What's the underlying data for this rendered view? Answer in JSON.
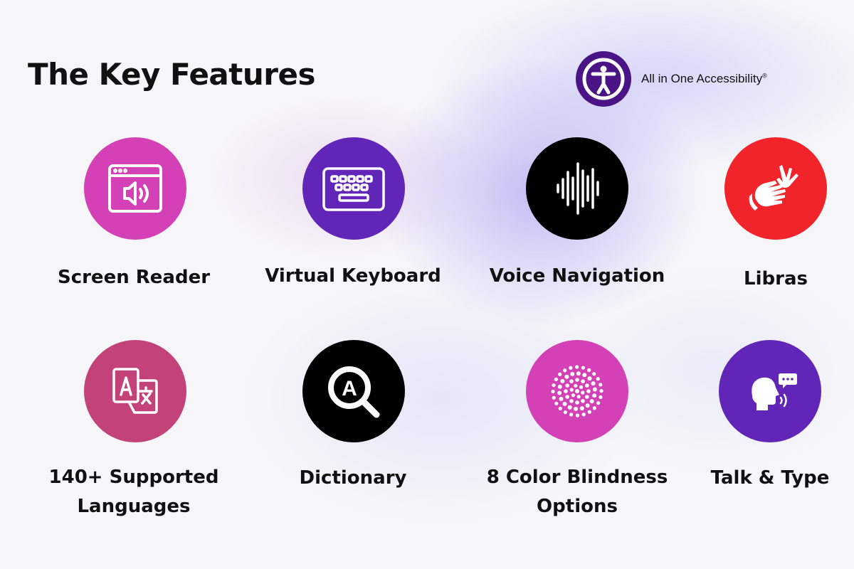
{
  "header": {
    "title": "The Key Features",
    "brand_name": "All in One Accessibility",
    "brand_mark": "®",
    "brand_color": "#4a1486"
  },
  "features": [
    {
      "label": "Screen Reader",
      "icon": "screen-reader-icon",
      "color": "#d441b6"
    },
    {
      "label": "Virtual Keyboard",
      "icon": "keyboard-icon",
      "color": "#6126b8"
    },
    {
      "label": "Voice Navigation",
      "icon": "sound-wave-icon",
      "color": "#000000"
    },
    {
      "label": "Libras",
      "icon": "sign-language-icon",
      "color": "#f0242a"
    },
    {
      "label_line1": "140+ Supported",
      "label_line2": "Languages",
      "icon": "translate-icon",
      "color": "#c34279"
    },
    {
      "label": "Dictionary",
      "icon": "magnifier-icon",
      "color": "#000000"
    },
    {
      "label_line1": "8 Color Blindness",
      "label_line2": "Options",
      "icon": "color-dots-icon",
      "color": "#d441b6"
    },
    {
      "label": "Talk & Type",
      "icon": "speaking-head-icon",
      "color": "#6126b8"
    }
  ]
}
